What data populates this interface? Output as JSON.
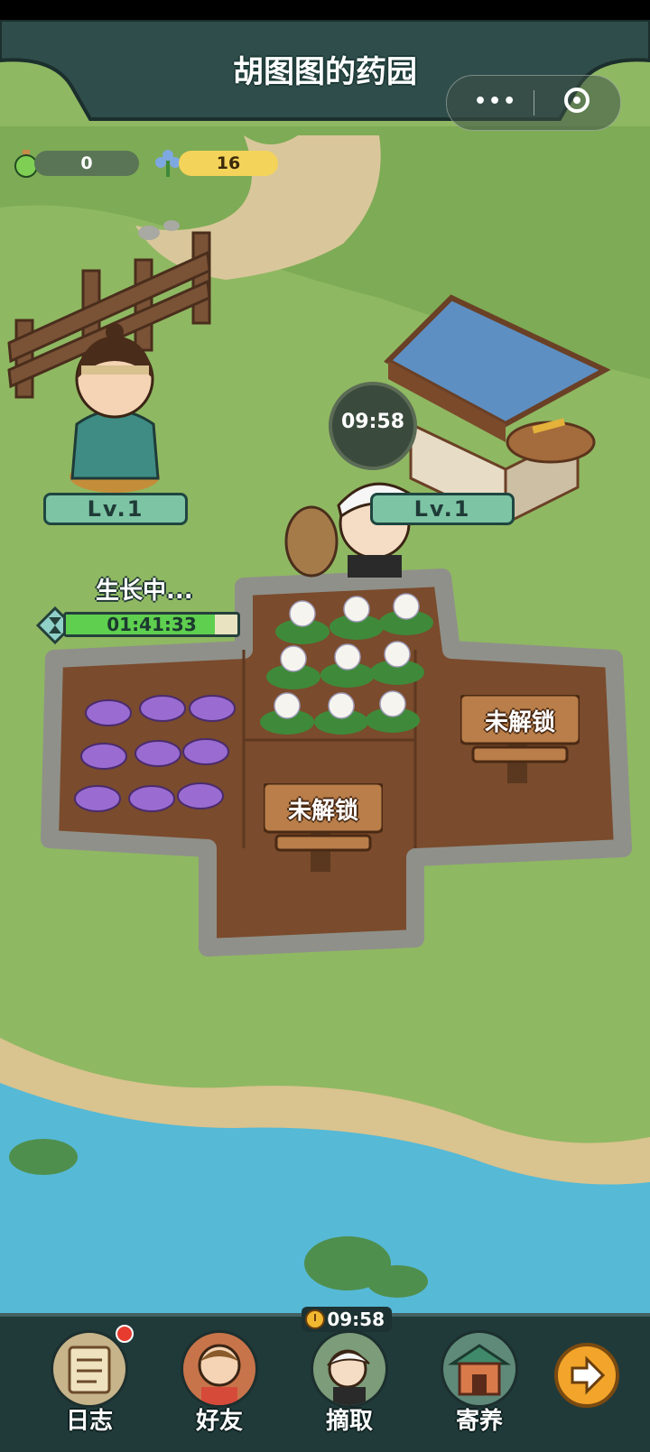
{
  "app": {
    "title": "胡图图的药园"
  },
  "resources": [
    {
      "icon": "potion-bottle-icon",
      "value": "0"
    },
    {
      "icon": "herb-flower-icon",
      "value": "16"
    }
  ],
  "herbalist": {
    "level": "Lv.1"
  },
  "shop": {
    "level": "Lv.1",
    "timer": "09:58"
  },
  "plot_growth": {
    "status": "生长中...",
    "time_left": "01:41:33",
    "progress": 0.87
  },
  "locked_plots": [
    {
      "label": "未解锁"
    },
    {
      "label": "未解锁"
    }
  ],
  "bottom_nav": {
    "pick_timer": "09:58",
    "items": [
      {
        "label": "日志",
        "icon": "scroll-log-icon",
        "has_badge": true
      },
      {
        "label": "好友",
        "icon": "friend-avatar-icon"
      },
      {
        "label": "摘取",
        "icon": "picker-character-icon"
      },
      {
        "label": "寄养",
        "icon": "pavilion-icon"
      }
    ],
    "next_icon": "arrow-right-icon"
  },
  "colors": {
    "grass": "#8fb862",
    "soil": "#7a4b2c",
    "water": "#56b9d6",
    "bar": "#203a3a",
    "accent": "#f2a52a"
  }
}
